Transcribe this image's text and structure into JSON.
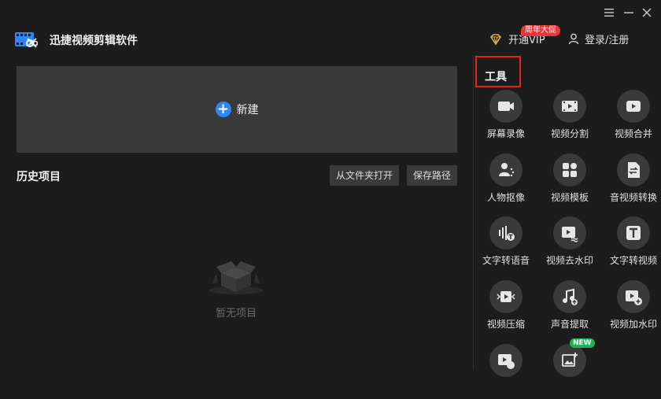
{
  "app": {
    "title": "迅捷视频剪辑软件",
    "vip_label": "开通VIP",
    "promo_badge": "周年大促",
    "login_label": "登录/注册"
  },
  "main": {
    "new_project_label": "新建",
    "history_title": "历史项目",
    "open_from_folder_label": "从文件夹打开",
    "save_path_label": "保存路径",
    "empty_label": "暂无项目"
  },
  "tools": {
    "title": "工具",
    "new_badge": "NEW",
    "items": [
      {
        "label": "屏幕录像",
        "icon": "screen-record-icon"
      },
      {
        "label": "视频分割",
        "icon": "video-split-icon"
      },
      {
        "label": "视频合并",
        "icon": "video-merge-icon"
      },
      {
        "label": "人物抠像",
        "icon": "person-cutout-icon"
      },
      {
        "label": "视频模板",
        "icon": "video-template-icon"
      },
      {
        "label": "音视频转换",
        "icon": "av-convert-icon"
      },
      {
        "label": "文字转语音",
        "icon": "text-to-speech-icon"
      },
      {
        "label": "视频去水印",
        "icon": "remove-watermark-icon"
      },
      {
        "label": "文字转视频",
        "icon": "text-to-video-icon"
      },
      {
        "label": "视频压缩",
        "icon": "video-compress-icon"
      },
      {
        "label": "声音提取",
        "icon": "audio-extract-icon"
      },
      {
        "label": "视频加水印",
        "icon": "add-watermark-icon"
      },
      {
        "label": "",
        "icon": "gif-icon"
      },
      {
        "label": "",
        "icon": "image-edit-icon"
      }
    ]
  },
  "colors": {
    "background": "#1c1c1c",
    "panel": "#3a3a3a",
    "accent": "#2f86f6",
    "highlight": "#e2231a",
    "promo": "#e8363a",
    "new_badge": "#20b25a",
    "vip_gold": "#d9a94e"
  }
}
